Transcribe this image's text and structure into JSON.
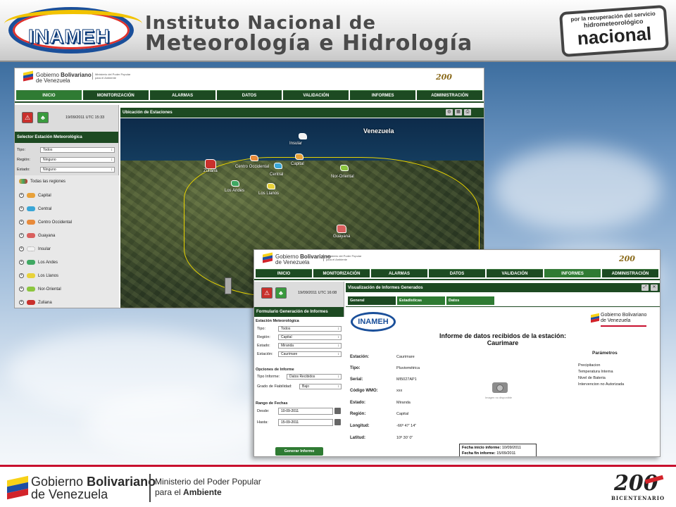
{
  "header": {
    "logo_text": "INAMEH",
    "institute_line1": "Instituto Nacional de",
    "institute_line2": "Meteorología e Hidrología",
    "badge": {
      "line1": "por la recuperación del servicio",
      "line2": "hidrometeorológico",
      "line3": "nacional"
    }
  },
  "window1": {
    "gov": {
      "line1": "Gobierno",
      "bold": "Bolivariano",
      "line2": "de Venezuela",
      "ministry1": "Ministerio del Poder Popular",
      "ministry2": "para el Ambiente",
      "years": "200"
    },
    "nav": [
      "INICIO",
      "MONITORIZACIÓN",
      "ALARMAS",
      "DATOS",
      "VALIDACIÓN",
      "INFORMES",
      "ADMINISTRACIÓN"
    ],
    "datetime": "19/09/2011 UTC 15:33",
    "selector_title": "Selector Estación Meteorológica",
    "filters": [
      {
        "label": "Tipo:",
        "value": "Todos"
      },
      {
        "label": "Región:",
        "value": "Ninguno"
      },
      {
        "label": "Estado:",
        "value": "Ninguno"
      }
    ],
    "all_regions": "Todas las regiones",
    "regions": [
      {
        "name": "Capital",
        "color": "#e8a13a"
      },
      {
        "name": "Central",
        "color": "#3aa6d6"
      },
      {
        "name": "Centro Occidental",
        "color": "#e88a3a"
      },
      {
        "name": "Guayana",
        "color": "#d9605e"
      },
      {
        "name": "Insular",
        "color": "#f2f2f2"
      },
      {
        "name": "Los Andes",
        "color": "#3fa862"
      },
      {
        "name": "Los Llanos",
        "color": "#e8d23a"
      },
      {
        "name": "Nor-Oriental",
        "color": "#8cc63f"
      },
      {
        "name": "Zuliana",
        "color": "#c9302c"
      }
    ],
    "map_title": "Ubicación de Estaciones",
    "map_labels": {
      "country": "Venezuela",
      "insular": "Insular",
      "zuliana": "Zuliana",
      "centro_occidental": "Centro Occidental",
      "capital": "Capital",
      "central": "Central",
      "los_andes": "Los Andes",
      "los_llanos": "Los Llanos",
      "nor_oriental": "Nor-Oriental",
      "guayana": "Guayana"
    }
  },
  "window2": {
    "gov": {
      "line1": "Gobierno",
      "bold": "Bolivariano",
      "line2": "de Venezuela",
      "ministry1": "Ministerio del Poder Popular",
      "ministry2": "para el Ambiente",
      "years": "200"
    },
    "nav": [
      "INICIO",
      "MONITORIZACIÓN",
      "ALARMAS",
      "DATOS",
      "VALIDACIÓN",
      "INFORMES",
      "ADMINISTRACIÓN"
    ],
    "datetime": "19/09/2011 UTC 16:08",
    "form_title": "Formulario Generación de Informes",
    "station_section": "Estación Meteorológica",
    "station_fields": [
      {
        "label": "Tipo:",
        "value": "Todos"
      },
      {
        "label": "Región:",
        "value": "Capital"
      },
      {
        "label": "Estado:",
        "value": "Miranda"
      },
      {
        "label": "Estación:",
        "value": "Caurimare"
      }
    ],
    "options_section": "Opciones de Informe",
    "report_type_label": "Tipo Informe:",
    "report_type_value": "Datos Recibidos",
    "reliability_label": "Grado de Fiabilidad:",
    "reliability_value": "Bajo",
    "dates_section": "Rango de Fechas",
    "from_label": "Desde:",
    "from_value": "10-09-2011",
    "to_label": "Hasta:",
    "to_value": "15-09-2011",
    "generate_button": "Generar Informe",
    "panel_title": "Visualización de Informes Generados",
    "tabs": [
      "General",
      "Estadísticas",
      "Datos"
    ],
    "report": {
      "logo": "INAMEH",
      "gov_line1": "Gobierno Bolivariano",
      "gov_line2": "de Venezuela",
      "title_line1": "Informe de datos recibidos de la estación:",
      "title_line2": "Caurimare",
      "fields": [
        {
          "label": "Estación:",
          "value": "Caurimare"
        },
        {
          "label": "Tipo:",
          "value": "Pluviométrica"
        },
        {
          "label": "Serial:",
          "value": "MI5027AP1"
        },
        {
          "label": "Código WMO:",
          "value": "xxx"
        },
        {
          "label": "Estado:",
          "value": "Miranda"
        },
        {
          "label": "Región:",
          "value": "Capital"
        },
        {
          "label": "Longitud:",
          "value": "-66º 47' 14\""
        },
        {
          "label": "Latitud:",
          "value": "10º 30' 0\""
        }
      ],
      "image_caption": "Imagen no disponible",
      "params_title": "Parámetros",
      "params": [
        "Precipitacion",
        "Temperatura Interna",
        "Nivel de Bateria",
        "Intervencion no Autorizada"
      ],
      "start_label": "Fecha inicio informe:",
      "start_value": "10/09/2011",
      "end_label": "Fecha fin informe:",
      "end_value": "15/09/2011"
    }
  },
  "footer": {
    "gov_line1_a": "Gobierno",
    "gov_line1_b": "Bolivariano",
    "gov_line2": "de Venezuela",
    "ministry_line1": "Ministerio del Poder Popular",
    "ministry_line2_a": "para el",
    "ministry_line2_b": "Ambiente",
    "bicentenario_number": "200",
    "bicentenario_word": "BICENTENARIO"
  }
}
